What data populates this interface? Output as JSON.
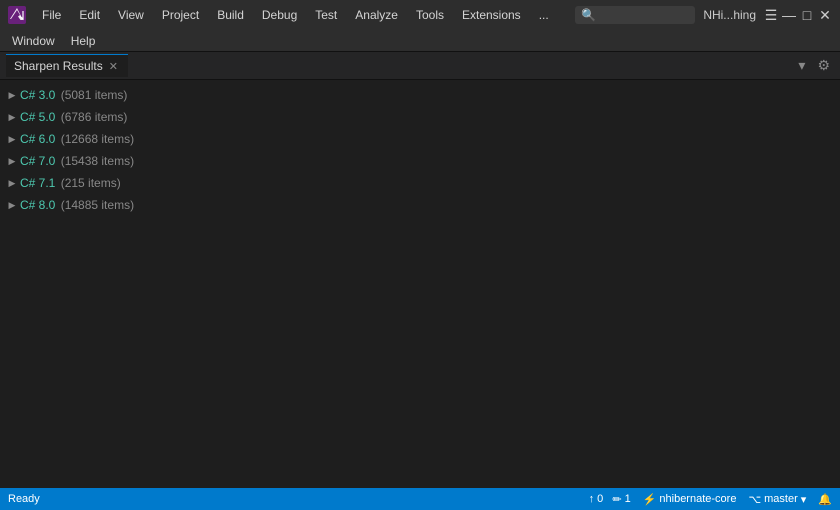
{
  "titleBar": {
    "title": "NHi...hing",
    "ellipsis": "...",
    "searchPlaceholder": "🔍"
  },
  "menuBar": {
    "items": [
      "File",
      "Edit",
      "View",
      "Project",
      "Build",
      "Debug",
      "Test",
      "Analyze",
      "Tools",
      "Extensions",
      "Window",
      "Help"
    ]
  },
  "panel": {
    "tabLabel": "Sharpen Results",
    "closeIcon": "✕",
    "chevronIcon": "▾",
    "gearIcon": "⚙"
  },
  "treeItems": [
    {
      "label": "C# 3.0",
      "count": "(5081 items)"
    },
    {
      "label": "C# 5.0",
      "count": "(6786 items)"
    },
    {
      "label": "C# 6.0",
      "count": "(12668 items)"
    },
    {
      "label": "C# 7.0",
      "count": "(15438 items)"
    },
    {
      "label": "C# 7.1",
      "count": "(215 items)"
    },
    {
      "label": "C# 8.0",
      "count": "(14885 items)"
    }
  ],
  "statusBar": {
    "ready": "Ready",
    "arrowUp": "↑",
    "arrowUpCount": "0",
    "pencilCount": "1",
    "repo": "nhibernate-core",
    "branch": "master",
    "bellIcon": "🔔"
  },
  "winControls": {
    "minimize": "—",
    "maximize": "□",
    "close": "✕"
  }
}
